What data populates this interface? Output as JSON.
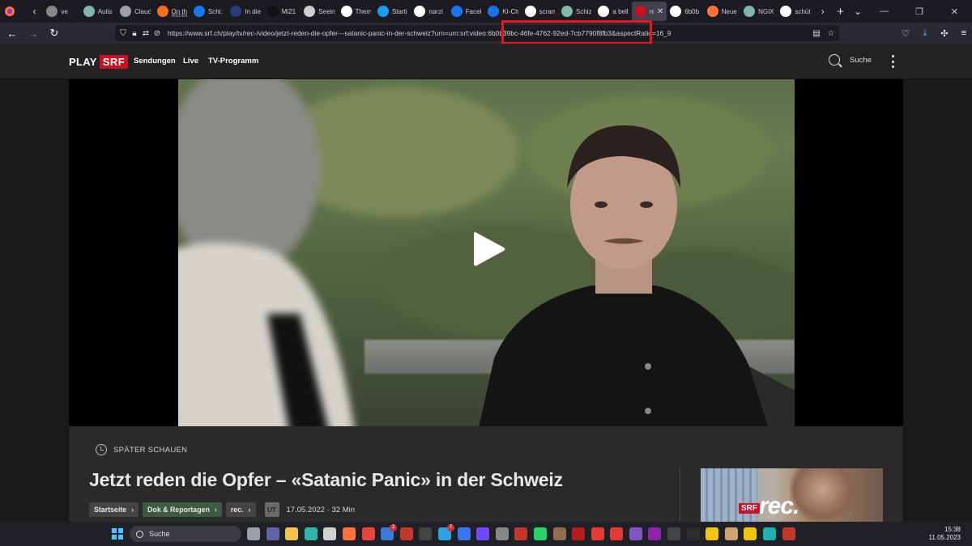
{
  "browser": {
    "tabs": [
      {
        "label": "ve",
        "icon": "page-icon",
        "color": "#888888"
      },
      {
        "label": "Autis",
        "icon": "chatgpt-icon",
        "color": "#7fb8a6"
      },
      {
        "label": "Claud",
        "icon": "wordpress-icon",
        "color": "#9aa0a6"
      },
      {
        "label": "On th",
        "sub": "WIEDER",
        "icon": "soundcloud-icon",
        "color": "#f26f23"
      },
      {
        "label": "Schi:",
        "icon": "facebook-icon",
        "color": "#1877f2"
      },
      {
        "label": "In die",
        "icon": "kv-icon",
        "color": "#2a3a7a"
      },
      {
        "label": "Mi21",
        "icon": "m-icon",
        "color": "#111111"
      },
      {
        "label": "Seein",
        "icon": "image-icon",
        "color": "#cfcfcf"
      },
      {
        "label": "Them",
        "icon": "sn-icon",
        "color": "#ffffff"
      },
      {
        "label": "Starti",
        "icon": "twitter-icon",
        "color": "#1d9bf0"
      },
      {
        "label": "narzi",
        "icon": "google-icon",
        "color": "#ffffff"
      },
      {
        "label": "Faceb",
        "icon": "facebook-icon",
        "color": "#1877f2"
      },
      {
        "label": "KI-Ch",
        "icon": "on-icon",
        "color": "#1a73e8"
      },
      {
        "label": "scram",
        "icon": "google-icon",
        "color": "#ffffff"
      },
      {
        "label": "Schiz",
        "icon": "chatgpt-icon",
        "color": "#7fb8a6"
      },
      {
        "label": "a bell",
        "icon": "google-icon",
        "color": "#ffffff"
      },
      {
        "label": "rec",
        "icon": "srf-icon",
        "color": "#c91024",
        "active": true
      },
      {
        "label": "6b0b",
        "icon": "google-icon",
        "color": "#ffffff"
      },
      {
        "label": "Neue",
        "icon": "firefox-icon",
        "color": "#ff7139"
      },
      {
        "label": "NGIX",
        "icon": "chatgpt-icon",
        "color": "#7fb8a6"
      },
      {
        "label": "schüt",
        "icon": "google-icon",
        "color": "#ffffff"
      }
    ],
    "url": "https://www.srf.ch/play/tv/rec-/video/jetzt-reden-die-opfer---satanic-panic-in-der-schweiz?urn=urn:srf:video:6b0b39bc-46fe-4762-92ed-7cb7790f8fb3&aspectRatio=16_9",
    "highlight_color": "#e8161b"
  },
  "srf": {
    "logo_play": "PLAY",
    "logo_srf": "SRF",
    "nav": [
      "Sendungen",
      "Live",
      "TV-Programm"
    ],
    "search_label": "Suche",
    "brand_color": "#c91024"
  },
  "video": {
    "later_label": "SPÄTER SCHAUEN",
    "title": "Jetzt reden die Opfer – «Satanic Panic» in der Schweiz",
    "breadcrumbs": [
      "Startseite",
      "Dok & Reportagen",
      "rec."
    ],
    "ut_badge": "UT",
    "meta": "17.05.2022 · 32 Min",
    "thumb_srf": "SRF",
    "thumb_rec": "rec."
  },
  "taskbar": {
    "search_label": "Suche",
    "time": "15:38",
    "date": "11.05.2023",
    "apps": [
      {
        "name": "taskview-icon",
        "color": "#9aa0a6"
      },
      {
        "name": "teams-icon",
        "color": "#6264a7"
      },
      {
        "name": "folder-icon",
        "color": "#f4c34d"
      },
      {
        "name": "edge-icon",
        "color": "#2fb6a8"
      },
      {
        "name": "store-icon",
        "color": "#d0d0d0"
      },
      {
        "name": "firefox-icon",
        "color": "#ff7139"
      },
      {
        "name": "chrome-icon",
        "color": "#e8453c"
      },
      {
        "name": "thunderbird-icon",
        "color": "#3a7bd5",
        "badge": "2"
      },
      {
        "name": "app-red-icon",
        "color": "#c0392b"
      },
      {
        "name": "bing-icon",
        "color": "#444444"
      },
      {
        "name": "telegram-icon",
        "color": "#2aa3e0",
        "badge": "7"
      },
      {
        "name": "signal-icon",
        "color": "#3a76f0"
      },
      {
        "name": "protonvpn-icon",
        "color": "#6d4aff"
      },
      {
        "name": "camera-icon",
        "color": "#888888"
      },
      {
        "name": "news-icon",
        "color": "#c0392b"
      },
      {
        "name": "whatsapp-icon",
        "color": "#25d366"
      },
      {
        "name": "books-icon",
        "color": "#8e6e4e"
      },
      {
        "name": "pdf-icon",
        "color": "#b71c1c"
      },
      {
        "name": "vivaldi-icon",
        "color": "#e53935"
      },
      {
        "name": "ccleaner-icon",
        "color": "#e53935"
      },
      {
        "name": "onion-icon",
        "color": "#7e57c2"
      },
      {
        "name": "podcast-icon",
        "color": "#8e24aa"
      },
      {
        "name": "app-71-icon",
        "color": "#444444"
      },
      {
        "name": "terminal-icon",
        "color": "#2d2d2d"
      },
      {
        "name": "linux-icon",
        "color": "#f1c40f"
      },
      {
        "name": "archive-icon",
        "color": "#caa472"
      },
      {
        "name": "linux2-icon",
        "color": "#f1c40f"
      },
      {
        "name": "vpn-icon",
        "color": "#20b2aa"
      },
      {
        "name": "notepad-icon",
        "color": "#c0392b"
      }
    ]
  }
}
